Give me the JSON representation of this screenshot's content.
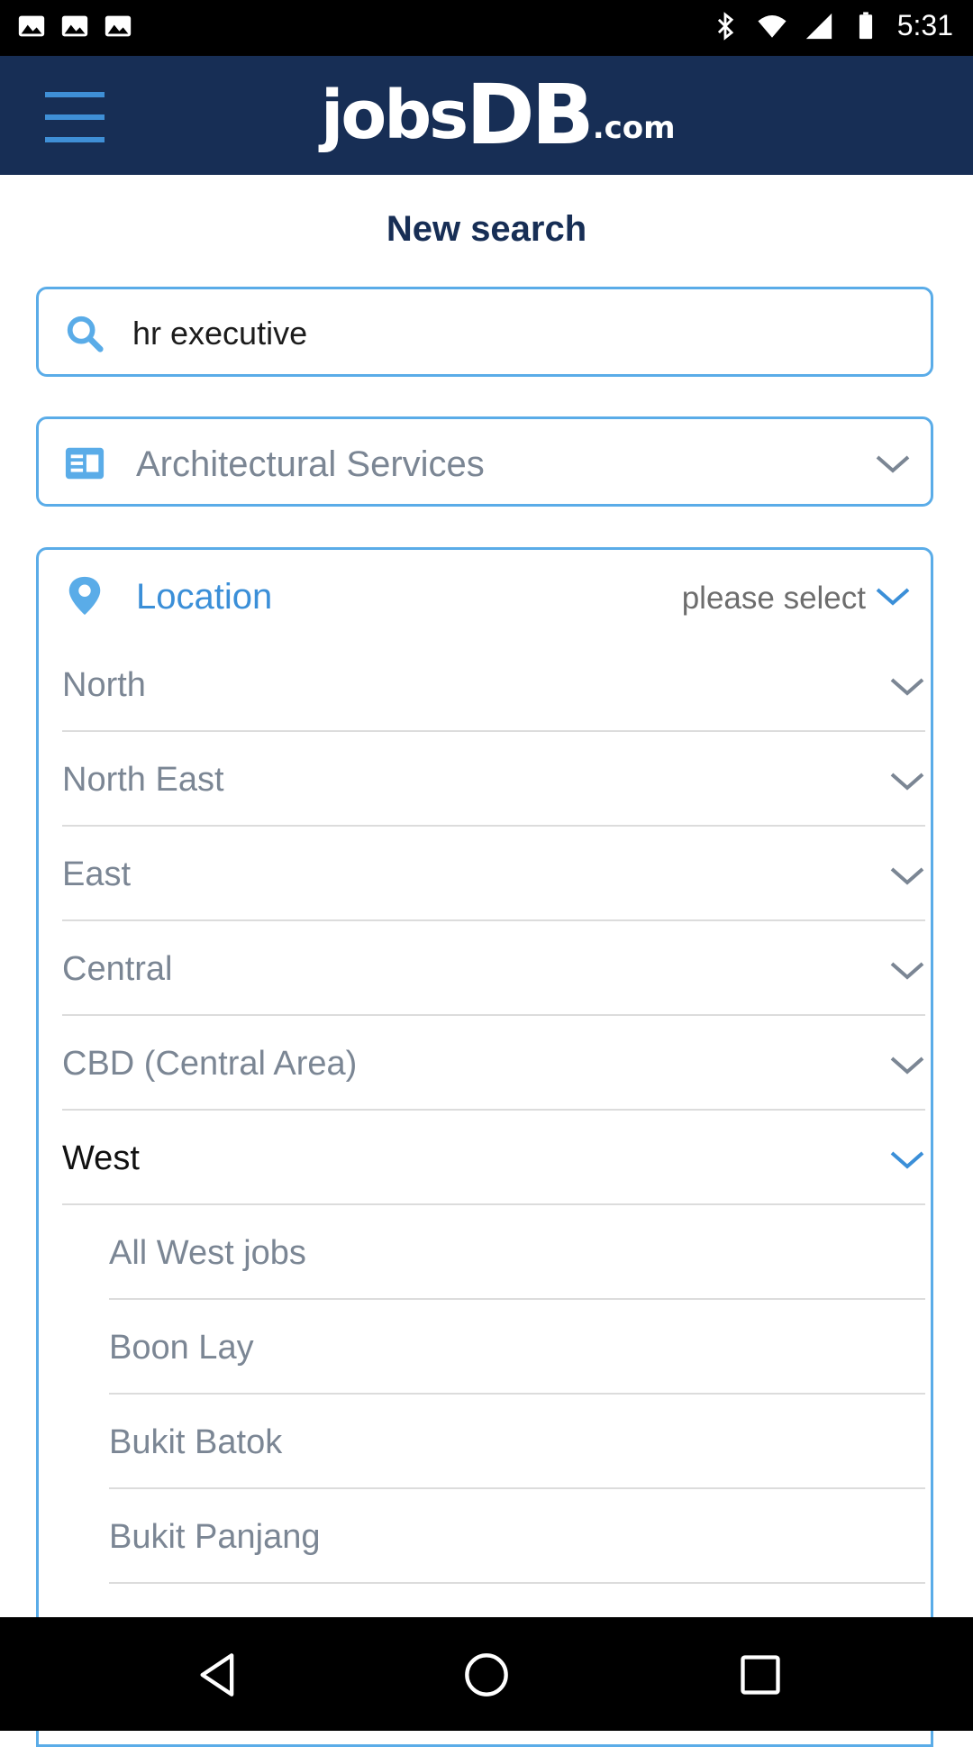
{
  "status_bar": {
    "time": "5:31"
  },
  "header": {
    "logo_main": "jobs",
    "logo_db": "DB",
    "logo_suffix": ".com"
  },
  "page": {
    "title": "New search"
  },
  "search": {
    "value": "hr executive"
  },
  "category": {
    "selected": "Architectural Services"
  },
  "location": {
    "label": "Location",
    "value": "please select"
  },
  "regions": [
    {
      "label": "North"
    },
    {
      "label": "North East"
    },
    {
      "label": "East"
    },
    {
      "label": "Central"
    },
    {
      "label": "CBD (Central Area)"
    },
    {
      "label": "West",
      "expanded": true
    }
  ],
  "west_areas": [
    {
      "label": "All West jobs"
    },
    {
      "label": "Boon Lay"
    },
    {
      "label": "Bukit Batok"
    },
    {
      "label": "Bukit Panjang"
    }
  ],
  "colors": {
    "brand_navy": "#172e55",
    "accent_blue": "#3b8fd8"
  }
}
